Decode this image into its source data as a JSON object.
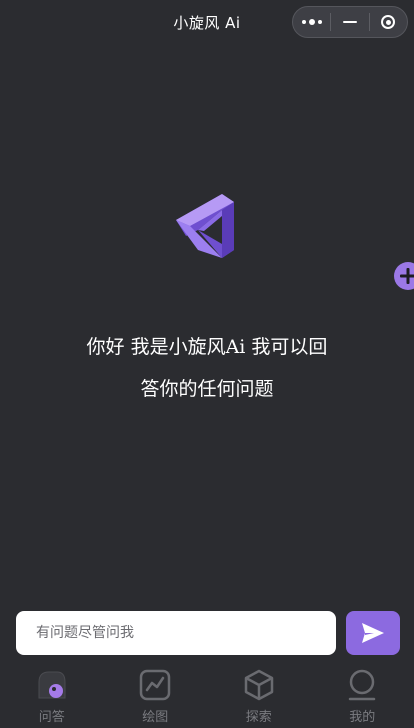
{
  "header": {
    "title": "小旋风 Ai",
    "capsule": {
      "more_icon": "more-dots-icon",
      "minimize_icon": "minus-icon",
      "close_icon": "target-circle-icon"
    }
  },
  "main": {
    "logo_icon": "triangle-logo-icon",
    "float_button_icon": "plus-icon",
    "welcome_line1": "你好 我是小旋风Ai 我可以回",
    "welcome_line2": "答你的任何问题"
  },
  "input": {
    "placeholder": "有问题尽管问我",
    "value": "",
    "send_icon": "send-icon"
  },
  "tabbar": {
    "items": [
      {
        "label": "问答",
        "icon": "chat-icon",
        "active": true
      },
      {
        "label": "绘图",
        "icon": "chart-icon",
        "active": false
      },
      {
        "label": "探索",
        "icon": "cube-icon",
        "active": false
      },
      {
        "label": "我的",
        "icon": "user-icon",
        "active": false
      }
    ]
  },
  "colors": {
    "background": "#2b2c30",
    "accent": "#8c6ae0",
    "tab_inactive": "#7a7b80"
  }
}
